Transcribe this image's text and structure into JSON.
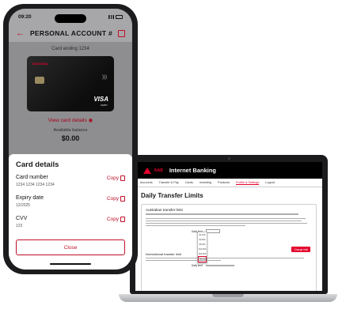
{
  "phone": {
    "status": {
      "time": "09:20"
    },
    "header": {
      "title": "PERSONAL ACCOUNT #"
    },
    "card": {
      "ending_text": "Card ending 1234",
      "issuer_logo": "NATIONAL",
      "network": "VISA",
      "network_sub": "DEBIT",
      "view_details_label": "View card details",
      "available_label": "Available balance",
      "balance": "$0.00"
    },
    "details": {
      "title": "Card details",
      "fields": [
        {
          "label": "Card number",
          "value": "1234 1234 1234 1234",
          "copy": "Copy"
        },
        {
          "label": "Expiry date",
          "value": "12/2025",
          "copy": "Copy"
        },
        {
          "label": "CVV",
          "value": "123",
          "copy": "Copy"
        }
      ],
      "close_label": "Close"
    }
  },
  "laptop": {
    "brand": "NAB",
    "app_title": "Internet Banking",
    "nav": [
      "Accounts",
      "Transfer & Pay",
      "Cards",
      "Investing",
      "Products",
      "Profile & Settings",
      "Logout"
    ],
    "page_title": "Daily Transfer Limits",
    "section_au": "Australian transfer limit",
    "section_intl": "International transfer limit",
    "daily_label": "Daily limit",
    "change_label": "Change limit",
    "dropdown_options": [
      "$1,000",
      "$2,500",
      "$5,000",
      "$10,000",
      "$20,000",
      "$50,000"
    ]
  },
  "colors": {
    "brand_red": "#e4002b",
    "accent_red": "#c0102a"
  },
  "icons": [
    "back-arrow-icon",
    "gift-icon",
    "eye-icon",
    "copy-icon",
    "nab-star-icon"
  ]
}
